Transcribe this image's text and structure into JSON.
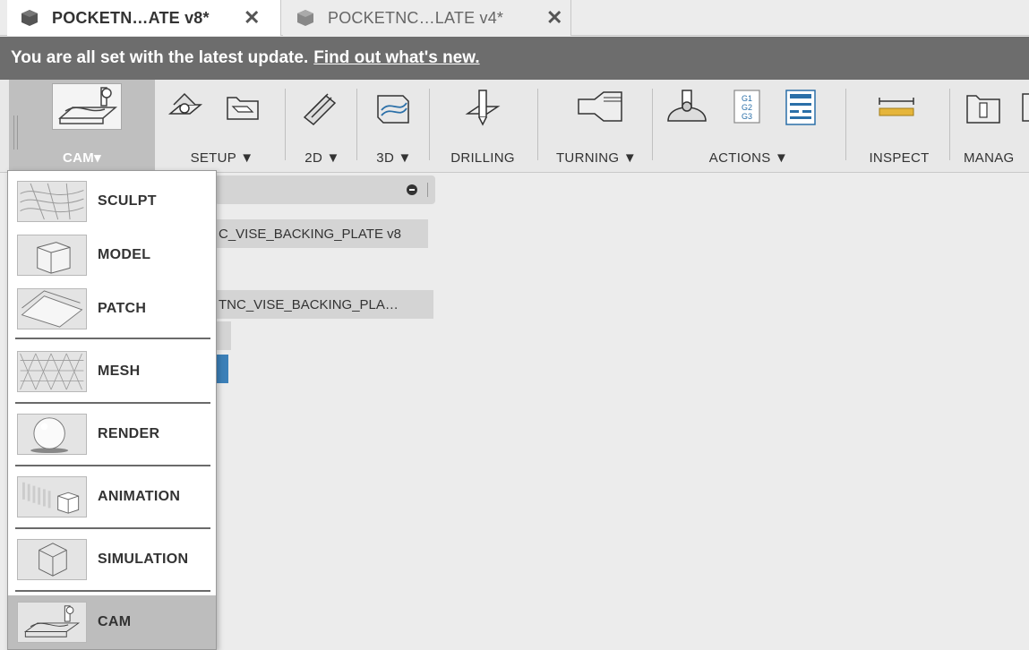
{
  "tabs": [
    {
      "title": "POCKETN…ATE v8*",
      "close": "✕",
      "active": true
    },
    {
      "title": "POCKETNC…LATE v4*",
      "close": "✕",
      "active": false
    }
  ],
  "banner": {
    "message": "You are all set with the latest update.",
    "link": "Find out what's new."
  },
  "toolbar": {
    "workspace_label": "CAM▾",
    "groups": [
      {
        "label": "SETUP ▼",
        "icons": [
          "setup-icon",
          "new-setup-folder-icon"
        ]
      },
      {
        "label": "2D ▼",
        "icons": [
          "2d-toolpath-icon"
        ]
      },
      {
        "label": "3D ▼",
        "icons": [
          "3d-toolpath-icon"
        ]
      },
      {
        "label": "DRILLING",
        "icons": [
          "drill-icon"
        ]
      },
      {
        "label": "TURNING ▼",
        "icons": [
          "turning-icon"
        ]
      },
      {
        "label": "ACTIONS ▼",
        "icons": [
          "simulate-icon",
          "post-process-icon",
          "setup-sheet-icon"
        ]
      },
      {
        "label": "INSPECT",
        "icons": [
          "measure-icon"
        ]
      },
      {
        "label": "MANAG",
        "icons": [
          "tool-library-icon"
        ]
      }
    ]
  },
  "browser": {
    "rows": [
      "C_VISE_BACKING_PLATE v8",
      "TNC_VISE_BACKING_PLA…"
    ]
  },
  "workspace_menu": {
    "items": [
      {
        "label": "SCULPT",
        "icon": "sculpt-icon"
      },
      {
        "label": "MODEL",
        "icon": "model-icon"
      },
      {
        "label": "PATCH",
        "icon": "patch-icon"
      },
      {
        "label": "MESH",
        "icon": "mesh-icon"
      },
      {
        "label": "RENDER",
        "icon": "render-icon"
      },
      {
        "label": "ANIMATION",
        "icon": "animation-icon"
      },
      {
        "label": "SIMULATION",
        "icon": "simulation-icon"
      },
      {
        "label": "CAM",
        "icon": "cam-icon",
        "selected": true
      }
    ]
  },
  "colors": {
    "banner_bg": "#6d6d6d",
    "selected_item_bg": "#bdbdbd",
    "highlight_blue": "#3c80b8"
  }
}
